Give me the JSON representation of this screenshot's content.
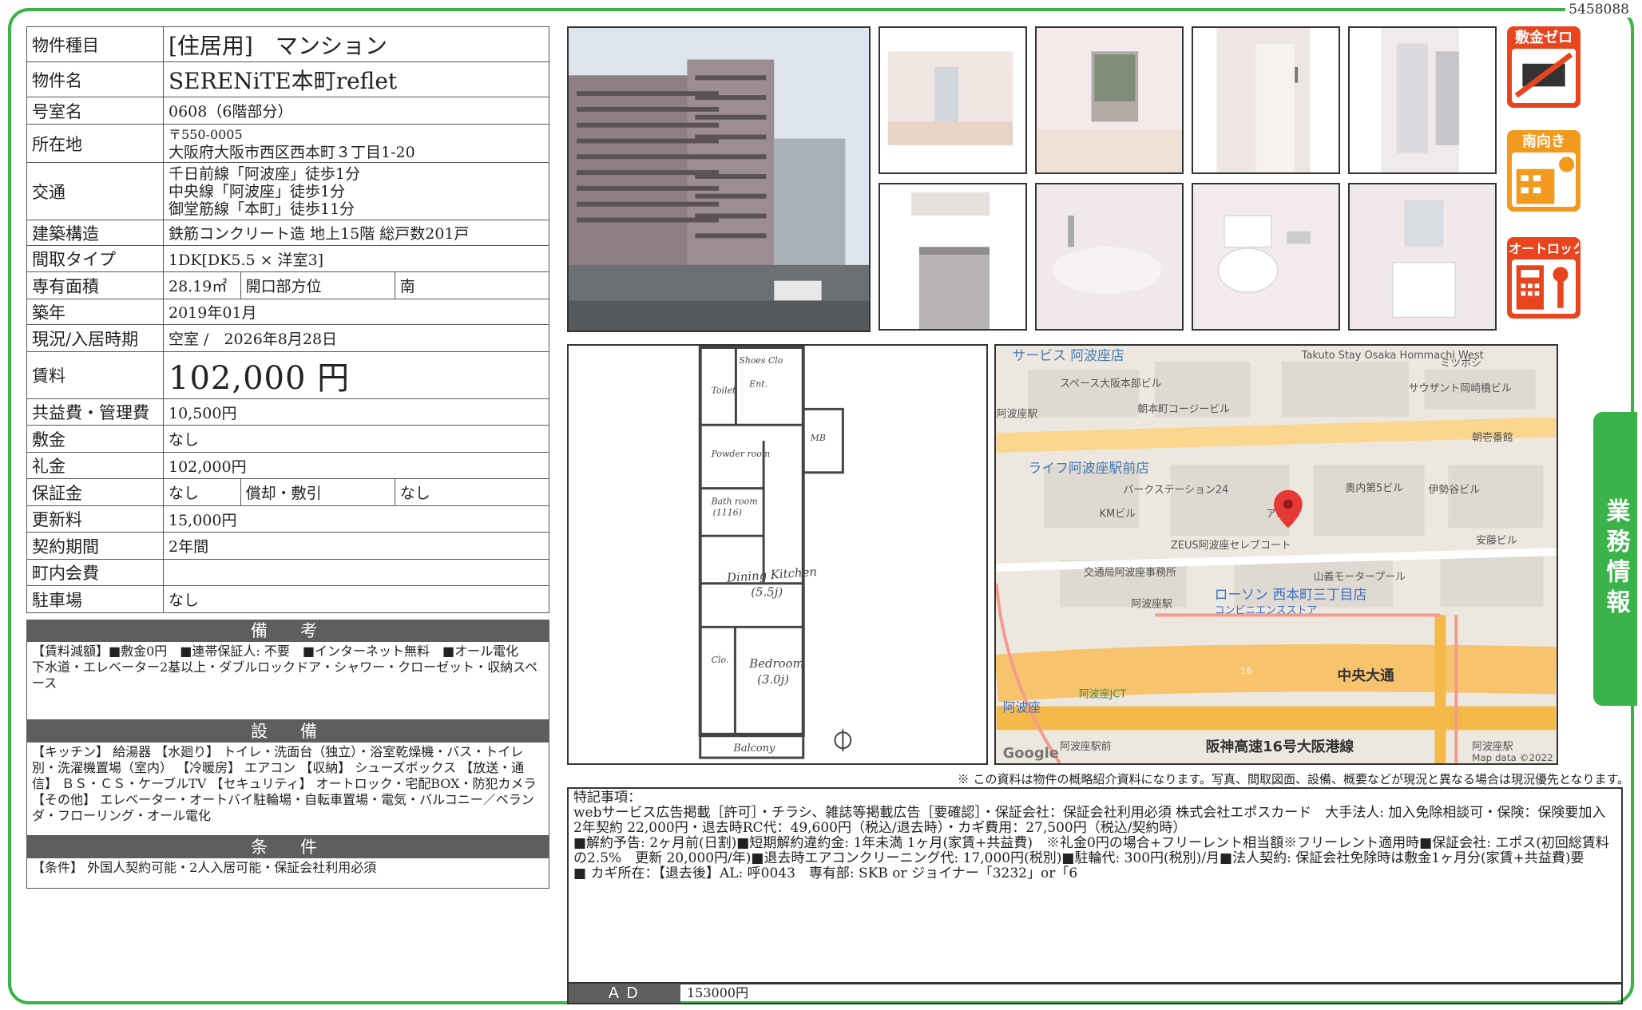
{
  "doc_id": "5458088",
  "property": {
    "type_label": "物件種目",
    "type_value": "[住居用]　マンション",
    "name_label": "物件名",
    "name_value": "SERENiTE本町reflet",
    "room_label": "号室名",
    "room_value": "0608（6階部分）",
    "address_label": "所在地",
    "postal": "〒550-0005",
    "address": "大阪府大阪市西区西本町３丁目1-20",
    "transit_label": "交通",
    "transit": [
      "千日前線「阿波座」徒歩1分",
      "中央線「阿波座」徒歩1分",
      "御堂筋線「本町」徒歩11分"
    ],
    "structure_label": "建築構造",
    "structure_value": "鉄筋コンクリート造 地上15階 総戸数201戸",
    "layout_label": "間取タイプ",
    "layout_value": "1DK[DK5.5 × 洋室3]",
    "area_label": "専有面積",
    "area_value": "28.19㎡",
    "direction_label": "開口部方位",
    "direction_value": "南",
    "built_label": "築年",
    "built_value": "2019年01月",
    "status_label": "現況/入居時期",
    "status_value": "空室 /　2026年8月28日",
    "rent_label": "賃料",
    "rent_value": "102,000 円",
    "fee_label": "共益費・管理費",
    "fee_value": "10,500円",
    "deposit_label": "敷金",
    "deposit_value": "なし",
    "key_money_label": "礼金",
    "key_money_value": "102,000円",
    "guarantee_label": "保証金",
    "guarantee_value": "なし",
    "amort_label": "償却・敷引",
    "amort_value": "なし",
    "renewal_label": "更新料",
    "renewal_value": "15,000円",
    "contract_label": "契約期間",
    "contract_value": "2年間",
    "town_fee_label": "町内会費",
    "town_fee_value": "",
    "parking_label": "駐車場",
    "parking_value": "なし"
  },
  "remarks": {
    "title": "備　考",
    "body": "【賃料減額】■敷金0円　■連帯保証人: 不要　■インターネット無料　■オール電化\n下水道・エレベーター2基以上・ダブルロックドア・シャワー・クローゼット・収納スペース"
  },
  "facilities": {
    "title": "設　備",
    "body": "【キッチン】 給湯器 【水廻り】 トイレ・洗面台（独立）・浴室乾燥機・バス・トイレ別・洗濯機置場（室内） 【冷暖房】 エアコン 【収納】 シューズボックス 【放送・通信】 ＢＳ・ＣＳ・ケーブルTV 【セキュリティ】 オートロック・宅配BOX・防犯カメラ 【その他】 エレベーター・オートバイ駐輪場・自転車置場・電気・バルコニー／ベランダ・フローリング・オール電化"
  },
  "conditions": {
    "title": "条　件",
    "body": "【条件】 外国人契約可能・2人入居可能・保証会社利用必須"
  },
  "badges": [
    {
      "label": "敷金ゼロ",
      "pic": "crossed-deposit"
    },
    {
      "label": "南向き",
      "pic": "sun-building"
    },
    {
      "label": "オートロック",
      "pic": "lock-keypad"
    }
  ],
  "floorplan": {
    "labels": {
      "shoe": "Shoes Clo",
      "ent": "Ent.",
      "toilet": "Toilet",
      "mb": "MB",
      "powder": "Powder room",
      "bath": "Bath room",
      "bath_size": "(1116)",
      "kitchen": "Dining Kitchen",
      "kitchen_size": "(5.5j)",
      "clo": "Clo.",
      "bedroom": "Bedroom",
      "bedroom_size": "(3.0j)",
      "balcony": "Balcony"
    }
  },
  "map": {
    "labels": {
      "top_left": "サービス 阿波座店",
      "takuto": "Takuto Stay Osaka Hommachi West",
      "mitsuboshi": "ミツボシ",
      "space": "スペース大阪本部ビル",
      "sunzant": "サウザント岡崎橋ビル",
      "awaza_st": "阿波座駅",
      "asamoto": "朝本町コージービル",
      "asahi": "朝壱番館",
      "life": "ライフ阿波座駅前店",
      "parking": "パークステーション24",
      "okuuchi": "奥内第5ビル",
      "isegaya": "伊勢谷ビル",
      "km": "KMビル",
      "a90": "ア90",
      "zeus": "ZEUS阿波座セレブコート",
      "anzen": "安藤ビル",
      "kotsu": "交通局阿波座事務所",
      "yamayoshi": "山義モータープール",
      "awaza_eki": "阿波座駅",
      "lawson": "ローソン 西本町三丁目店",
      "conv": "コンビニエンスストア",
      "route16": "16",
      "chuo": "中央大通",
      "awaza": "阿波座",
      "jct": "阿波座JCT",
      "hanshin": "阪神高速16号大阪港線",
      "awaza_mae": "阿波座駅前",
      "awaza_r": "阿波座駅",
      "google": "Google",
      "mapdata": "Map data ©2022"
    }
  },
  "disclaimer": "※ この資料は物件の概略紹介資料になります。写真、間取図面、設備、概要などが現況と異なる場合は現況優先となります。",
  "notes": {
    "title": "特記事項：",
    "body": "webサービス広告掲載［許可］・チラシ、雑誌等掲載広告［要確認］・保証会社：保証会社利用必須 株式会社エポスカード　大手法人: 加入免除相談可・保険：保険要加入 2年契約 22,000円・退去時RC代：49,600円（税込/退去時）・カギ費用：27,500円（税込/契約時）\n■解約予告: 2ヶ月前(日割)■短期解約違約金: 1年未満 1ヶ月(家賃+共益費)　※礼金0円の場合+フリーレント相当額※フリーレント適用時■保証会社: エポス(初回総賃料の2.5%　更新 20,000円/年)■退去時エアコンクリーニング代: 17,000円(税別)■駐輪代: 300円(税別)/月■法人契約: 保証会社免除時は敷金1ヶ月分(家賃+共益費)要\n■ カギ所在：【退去後】AL: 呼0043　専有部: SKB or ジョイナー「3232」or「6"
  },
  "ad": {
    "label": "ＡＤ",
    "value": "153000円"
  },
  "side_tab": "業務情報",
  "colors": {
    "frame": "#3ab34a",
    "header_gray": "#5e5e5e",
    "badge_red": "#e8451e",
    "badge_orange": "#f29a1e",
    "map_route": "#f5b94a",
    "pin": "#e53935"
  }
}
